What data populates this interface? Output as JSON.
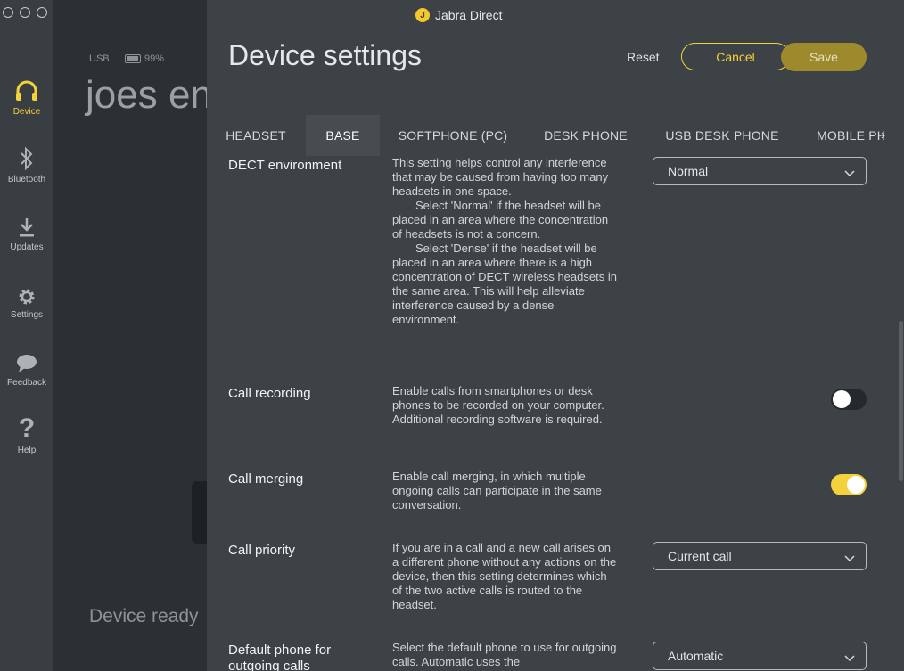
{
  "window": {
    "title": "Jabra Direct",
    "logo_letter": "J"
  },
  "sidebar": {
    "items": [
      {
        "label": "Device",
        "icon": "headset-icon",
        "active": true
      },
      {
        "label": "Bluetooth",
        "icon": "bluetooth-icon"
      },
      {
        "label": "Updates",
        "icon": "download-icon"
      },
      {
        "label": "Settings",
        "icon": "gear-icon"
      },
      {
        "label": "Feedback",
        "icon": "speech-bubble-icon"
      },
      {
        "label": "Help",
        "icon": "question-icon"
      }
    ]
  },
  "background": {
    "connection": "USB",
    "battery": "99%",
    "device_name": "joes en",
    "status": "Device ready"
  },
  "header": {
    "title": "Device settings",
    "reset_label": "Reset",
    "cancel_label": "Cancel",
    "save_label": "Save"
  },
  "tabs": [
    {
      "label": "HEADSET"
    },
    {
      "label": "BASE",
      "active": true
    },
    {
      "label": "SOFTPHONE (PC)"
    },
    {
      "label": "DESK PHONE"
    },
    {
      "label": "USB DESK PHONE"
    },
    {
      "label": "MOBILE PH"
    }
  ],
  "settings": {
    "dect": {
      "title": "DECT environment",
      "desc1": "This setting helps control any interference that may be caused from having too many headsets in one space.",
      "desc2": "Select 'Normal' if the headset will be placed in an area where the concentration of headsets is not a concern.",
      "desc3": "Select 'Dense' if the headset will be placed in an area where there is a high concentration of DECT wireless headsets in the same area. This will help alleviate interference caused by a dense environment.",
      "value": "Normal"
    },
    "recording": {
      "title": "Call recording",
      "desc": "Enable calls from smartphones or desk phones to be recorded on your computer. Additional recording software is required.",
      "enabled": false
    },
    "merging": {
      "title": "Call merging",
      "desc": "Enable call merging, in which multiple ongoing calls can participate in the same conversation.",
      "enabled": true
    },
    "priority": {
      "title": "Call priority",
      "desc": "If you are in a call and a new call arises on a different phone without any actions on the device, then this setting determines which of the two active calls is routed to the headset.",
      "value": "Current call"
    },
    "default_phone": {
      "title": "Default phone for outgoing calls",
      "desc": "Select the default phone to use for outgoing calls. Automatic uses the",
      "value": "Automatic"
    }
  },
  "colors": {
    "accent": "#f4d23c",
    "save": "#9c8a2c",
    "background": "#3d4247"
  }
}
